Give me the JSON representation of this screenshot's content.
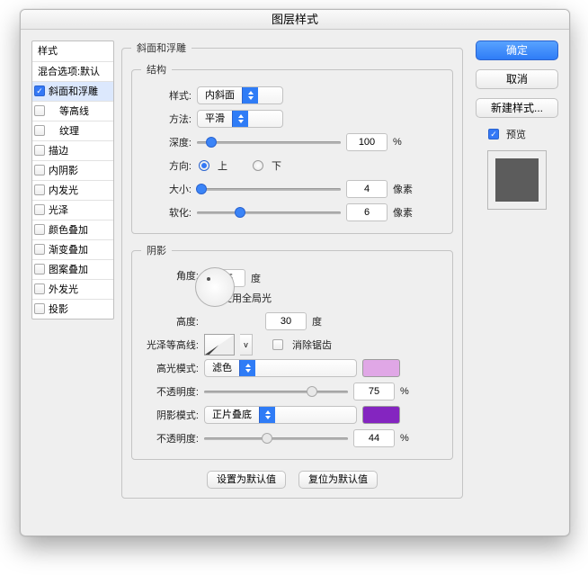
{
  "title": "图层样式",
  "sidebar": {
    "heading1": "样式",
    "heading2": "混合选项:默认",
    "items": [
      "斜面和浮雕",
      "等高线",
      "纹理",
      "描边",
      "内阴影",
      "内发光",
      "光泽",
      "颜色叠加",
      "渐变叠加",
      "图案叠加",
      "外发光",
      "投影"
    ]
  },
  "panel": {
    "heading": "斜面和浮雕"
  },
  "structure": {
    "legend": "结构",
    "style": {
      "label": "样式:",
      "value": "内斜面"
    },
    "technique": {
      "label": "方法:",
      "value": "平滑"
    },
    "depth": {
      "label": "深度:",
      "value": "100"
    },
    "direction": {
      "label": "方向:",
      "up": "上",
      "down": "下"
    },
    "size": {
      "label": "大小:",
      "value": "4"
    },
    "soften": {
      "label": "软化:",
      "value": "6"
    }
  },
  "shading": {
    "legend": "阴影",
    "angle": {
      "label": "角度:",
      "value": "125"
    },
    "useGlobal": "使用全局光",
    "altitude": {
      "label": "高度:",
      "value": "30"
    },
    "glossContour": "光泽等高线:",
    "antiAlias": "消除锯齿",
    "hlMode": {
      "label": "高光模式:",
      "value": "滤色"
    },
    "hlOpacity": {
      "label": "不透明度:",
      "value": "75"
    },
    "hlColorStyle": "background:#e0a7e6",
    "shMode": {
      "label": "阴影模式:",
      "value": "正片叠底"
    },
    "shOpacity": {
      "label": "不透明度:",
      "value": "44"
    },
    "shColorStyle": "background:#8425c0"
  },
  "footer": {
    "makeDefault": "设置为默认值",
    "resetDefault": "复位为默认值"
  },
  "right": {
    "ok": "确定",
    "cancel": "取消",
    "newStyle": "新建样式...",
    "preview": "预览"
  },
  "units": {
    "percent": "%",
    "px": "像素",
    "degree": "度"
  }
}
